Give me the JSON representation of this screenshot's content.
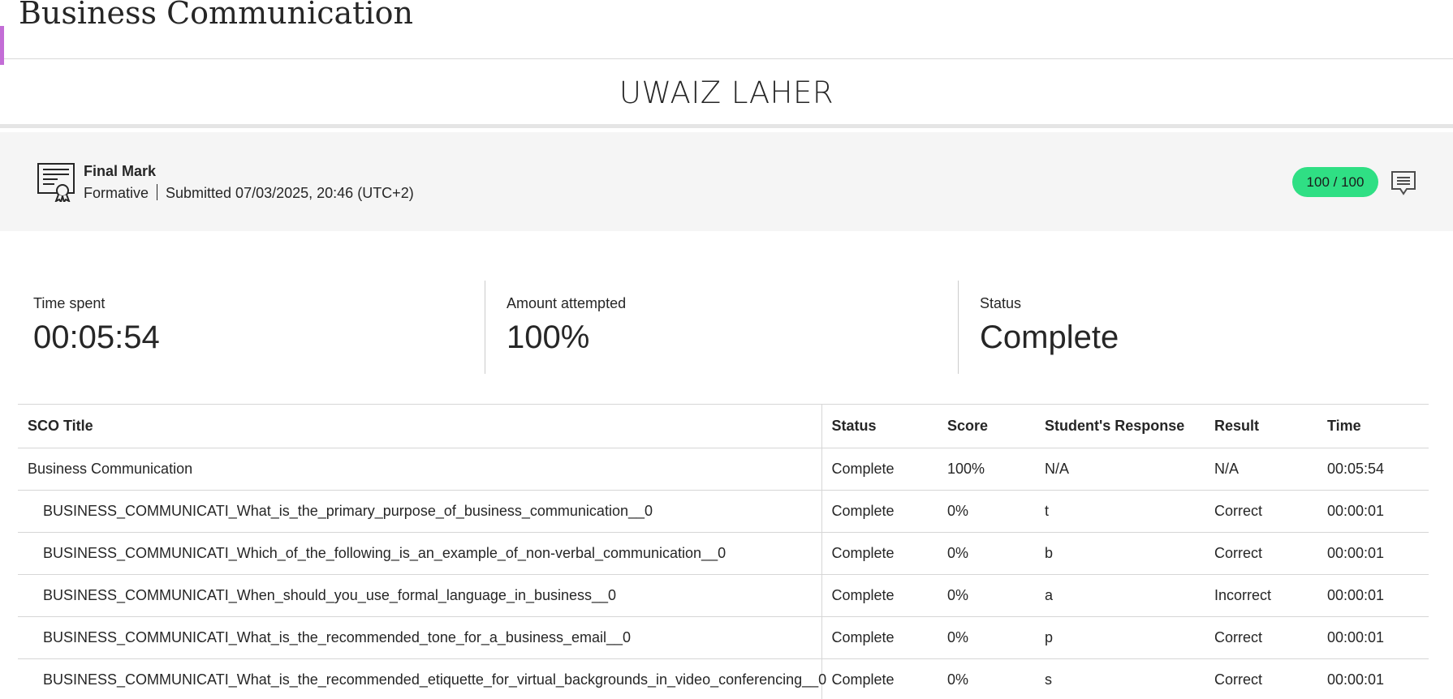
{
  "course": {
    "title": "Business Communication",
    "accent_color": "#c36dd6"
  },
  "student": {
    "name": "UWAIZ LAHER"
  },
  "grade": {
    "icon": "certificate-icon",
    "title": "Final Mark",
    "type": "Formative",
    "submitted": "Submitted 07/03/2025, 20:46 (UTC+2)",
    "score": "100 / 100",
    "score_color": "#2fdf84",
    "comment_icon": "comment-icon"
  },
  "stats": {
    "time_spent": {
      "label": "Time spent",
      "value": "00:05:54"
    },
    "amount_attempted": {
      "label": "Amount attempted",
      "value": "100%"
    },
    "status": {
      "label": "Status",
      "value": "Complete"
    }
  },
  "table": {
    "headers": {
      "title": "SCO Title",
      "status": "Status",
      "score": "Score",
      "response": "Student's Response",
      "result": "Result",
      "time": "Time"
    },
    "rows": [
      {
        "title": "Business Communication",
        "status": "Complete",
        "score": "100%",
        "response": "N/A",
        "result": "N/A",
        "time": "00:05:54"
      },
      {
        "title": "BUSINESS_COMMUNICATI_What_is_the_primary_purpose_of_business_communication__0",
        "status": "Complete",
        "score": "0%",
        "response": "t",
        "result": "Correct",
        "time": "00:00:01"
      },
      {
        "title": "BUSINESS_COMMUNICATI_Which_of_the_following_is_an_example_of_non-verbal_communication__0",
        "status": "Complete",
        "score": "0%",
        "response": "b",
        "result": "Correct",
        "time": "00:00:01"
      },
      {
        "title": "BUSINESS_COMMUNICATI_When_should_you_use_formal_language_in_business__0",
        "status": "Complete",
        "score": "0%",
        "response": "a",
        "result": "Incorrect",
        "time": "00:00:01"
      },
      {
        "title": "BUSINESS_COMMUNICATI_What_is_the_recommended_tone_for_a_business_email__0",
        "status": "Complete",
        "score": "0%",
        "response": "p",
        "result": "Correct",
        "time": "00:00:01"
      },
      {
        "title": "BUSINESS_COMMUNICATI_What_is_the_recommended_etiquette_for_virtual_backgrounds_in_video_conferencing__0",
        "status": "Complete",
        "score": "0%",
        "response": "s",
        "result": "Correct",
        "time": "00:00:01"
      }
    ]
  }
}
